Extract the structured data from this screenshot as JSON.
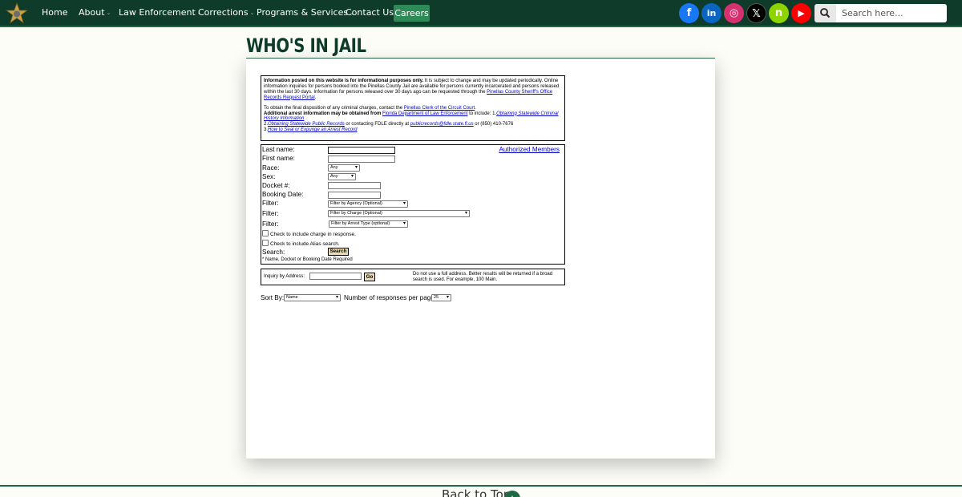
{
  "nav": {
    "logo_icon": "sheriff-star-icon",
    "items": [
      {
        "label": "Home",
        "dropdown": false
      },
      {
        "label": "About",
        "dropdown": true
      },
      {
        "label": "Law Enforcement",
        "dropdown": true
      },
      {
        "label": "Corrections",
        "dropdown": true
      },
      {
        "label": "Programs & Services",
        "dropdown": true
      },
      {
        "label": "Contact Us",
        "dropdown": false
      }
    ],
    "careers_label": "Careers",
    "social": [
      {
        "name": "facebook-icon",
        "glyph": "f",
        "color": "#1877f2"
      },
      {
        "name": "linkedin-icon",
        "glyph": "in",
        "color": "#0a66c2"
      },
      {
        "name": "instagram-icon",
        "glyph": "◎",
        "color": "#d6306f"
      },
      {
        "name": "x-icon",
        "glyph": "𝕏",
        "color": "#000000"
      },
      {
        "name": "nextdoor-icon",
        "glyph": "n",
        "color": "#8ed500"
      },
      {
        "name": "youtube-icon",
        "glyph": "▶",
        "color": "#ff0000"
      }
    ],
    "search_placeholder": "Search here..."
  },
  "page_title": "WHO'S IN JAIL",
  "info": {
    "p1_bold": "Information posted on this website is for informational purposes only.",
    "p1_text": " It is subject to change and may be updated periodically. Online information inquiries for persons booked into the Pinellas County Jail are available for persons currently incarcerated and persons released within the last 30 days. Information for persons released over 30 days ago can be requested through the ",
    "p1_link": "Pinellas County Sheriff's Office Records Request Portal",
    "p2_text": "To obtain the final disposition of any criminal charges, contact the ",
    "p2_link": "Pinellas Clerk of the Circuit Court",
    "p3_bold": "Additional arrest information may be obtained from ",
    "p3_link": "Florida Department of Law Enforcement",
    "p3_text": " to include: 1.",
    "p3_link2": "Obtaining Statewide Criminal History Information",
    "p4_prefix": "2.",
    "p4_link": "Obtaining Statewide Public Records",
    "p4_text": " or contacting FDLE directly at ",
    "p4_email": "publicrecords@fdle.state.fl.us",
    "p4_phone": " or (850) 410-7676",
    "p5_prefix": "3.",
    "p5_link": "How to Seal or Expunge an Arrest Record"
  },
  "form": {
    "authorized_members": "Authorized Members",
    "last_name_label": "Last name:",
    "first_name_label": "First name:",
    "race_label": "Race:",
    "race_value": "Any",
    "sex_label": "Sex:",
    "sex_value": "Any",
    "docket_label": "Docket #:",
    "booking_date_label": "Booking Date:",
    "filter_label": "Filter:",
    "agency_filter": "Filter by Agency (Optional)",
    "charge_filter": "Filter by Charge (Optional)",
    "arrest_type_filter": "Filter by Arrest Type (optional)",
    "include_charge": "Check to include charge in response.",
    "include_alias": "Check to include Alias search.",
    "search_label": "Search:",
    "search_button": "Search",
    "required_note": "* Name, Docket or Booking Date Required"
  },
  "address": {
    "label": "Inquiry by Address:",
    "go_button": "Go",
    "hint": "Do not use a full address. Better results will be returned if a broad search is used. For example, 100 Main."
  },
  "sort": {
    "sort_label": "Sort By:",
    "sort_value": "Name",
    "responses_label": "Number of responses per page:",
    "responses_value": "25"
  },
  "footer": {
    "back_to_top": "Back to Top"
  }
}
